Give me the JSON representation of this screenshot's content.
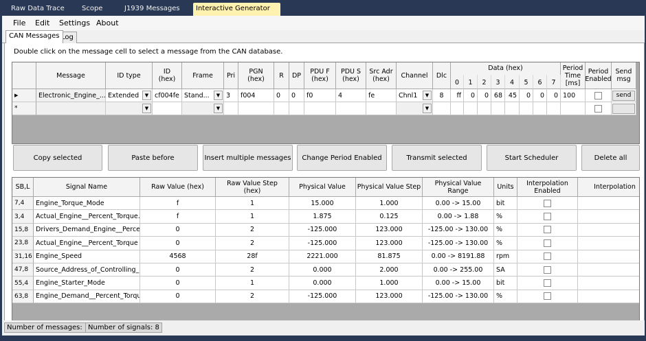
{
  "tabs": [
    "Raw Data Trace",
    "Scope",
    "J1939 Messages",
    "Interactive Generator"
  ],
  "tab_close": "✕",
  "menu": [
    "File",
    "Edit",
    "Settings",
    "About"
  ],
  "subtabs": [
    "CAN Messages",
    "Log"
  ],
  "hint": "Double click on the message cell to select a message from the CAN database.",
  "msg_headers": {
    "message": "Message",
    "id_type": "ID type",
    "id_hex": "ID\n(hex)",
    "frame": "Frame",
    "pri": "Pri",
    "pgn": "PGN\n(hex)",
    "r": "R",
    "dp": "DP",
    "pduf": "PDU F\n(hex)",
    "pdus": "PDU S\n(hex)",
    "src": "Src Adr\n(hex)",
    "channel": "Channel",
    "dlc": "Dlc",
    "data": "Data (hex)",
    "bytes": [
      "0",
      "1",
      "2",
      "3",
      "4",
      "5",
      "6",
      "7"
    ],
    "period": "Period\nTime\n[ms]",
    "period_enabled": "Period\nEnabled",
    "send": "Send\nmsg"
  },
  "msg_rows": [
    {
      "marker": "▶",
      "message": "Electronic_Engine_...",
      "id_type": "Extended",
      "id_hex": "cf004fe",
      "frame": "Stand...",
      "pri": "3",
      "pgn": "f004",
      "r": "0",
      "dp": "0",
      "pduf": "f0",
      "pdus": "4",
      "src": "fe",
      "channel": "Chnl1",
      "dlc": "8",
      "data": [
        "ff",
        "0",
        "0",
        "68",
        "45",
        "0",
        "0",
        "0"
      ],
      "period": "100",
      "period_enabled": false,
      "send": "send"
    }
  ],
  "new_row_marker": "*",
  "buttons": [
    "Copy selected",
    "Paste before",
    "Insert multiple messages",
    "Change Period Enabled",
    "Transmit selected",
    "Start Scheduler",
    "Delete all"
  ],
  "sig_headers": [
    "SB,L",
    "Signal Name",
    "Raw Value (hex)",
    "Raw Value Step\n(hex)",
    "Physical Value",
    "Physical Value Step",
    "Physical Value\nRange",
    "Units",
    "Interpolation\nEnabled",
    "Interpolation"
  ],
  "sig_rows": [
    [
      "7,4",
      "Engine_Torque_Mode",
      "f",
      "1",
      "15.000",
      "1.000",
      "0.00 -> 15.00",
      "bit"
    ],
    [
      "3,4",
      "Actual_Engine__Percent_Torque...",
      "f",
      "1",
      "1.875",
      "0.125",
      "0.00 -> 1.88",
      "%"
    ],
    [
      "15,8",
      "Drivers_Demand_Engine__Perce...",
      "0",
      "2",
      "-125.000",
      "123.000",
      "-125.00 -> 130.00",
      "%"
    ],
    [
      "23,8",
      "Actual_Engine__Percent_Torque",
      "0",
      "2",
      "-125.000",
      "123.000",
      "-125.00 -> 130.00",
      "%"
    ],
    [
      "31,16",
      "Engine_Speed",
      "4568",
      "28f",
      "2221.000",
      "81.875",
      "0.00 -> 8191.88",
      "rpm"
    ],
    [
      "47,8",
      "Source_Address_of_Controlling_D...",
      "0",
      "2",
      "0.000",
      "2.000",
      "0.00 -> 255.00",
      "SA"
    ],
    [
      "55,4",
      "Engine_Starter_Mode",
      "0",
      "1",
      "0.000",
      "1.000",
      "0.00 -> 15.00",
      "bit"
    ],
    [
      "63,8",
      "Engine_Demand__Percent_Torque",
      "0",
      "2",
      "-125.000",
      "123.000",
      "-125.00 -> 130.00",
      "%"
    ]
  ],
  "status": [
    "Number of messages: 1",
    "Number of signals: 8"
  ]
}
